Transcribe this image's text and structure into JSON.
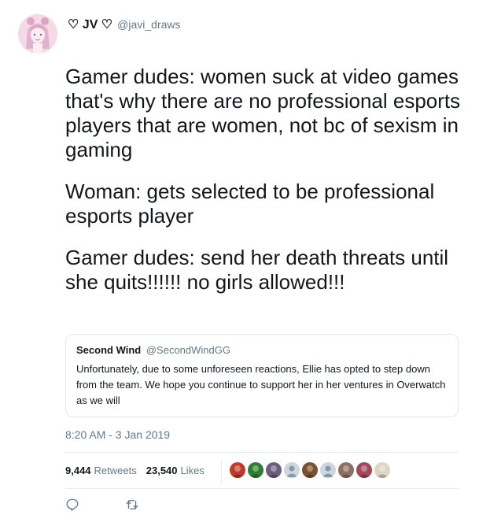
{
  "author": {
    "name": "♡ JV ♡",
    "handle": "@javi_draws"
  },
  "tweet": {
    "paragraphs": [
      "Gamer dudes: women suck at video games that's why there are no professional esports players that are women, not bc of sexism in gaming",
      "Woman: gets selected to be professional esports player",
      "Gamer dudes: send her death threats until she quits!!!!!! no girls allowed!!!"
    ]
  },
  "quoted_tweet": {
    "name": "Second Wind",
    "handle": "@SecondWindGG",
    "text": "Unfortunately, due to some unforeseen reactions, Ellie has opted to step down from the team. We hope you continue to support her in her ventures in Overwatch as we will"
  },
  "timestamp": "8:20 AM - 3 Jan 2019",
  "stats": {
    "retweets_count": "9,444",
    "retweets_label": "Retweets",
    "likes_count": "23,540",
    "likes_label": "Likes"
  },
  "likers": [
    {
      "icon": "liker-avatar-icon",
      "color": "#c0392b"
    },
    {
      "icon": "liker-avatar-icon",
      "color": "#2e7d32"
    },
    {
      "icon": "liker-avatar-icon",
      "color": "#6d5c7e"
    },
    {
      "icon": "default-avatar-icon",
      "color": "#ccd6dd"
    },
    {
      "icon": "liker-avatar-icon",
      "color": "#7a5230"
    },
    {
      "icon": "default-avatar-icon",
      "color": "#ccd6dd"
    },
    {
      "icon": "liker-avatar-icon",
      "color": "#8d6e63"
    },
    {
      "icon": "liker-avatar-icon",
      "color": "#a1485a"
    },
    {
      "icon": "liker-avatar-icon",
      "color": "#e0d5c5"
    }
  ],
  "actions": [
    {
      "icon": "reply-icon"
    },
    {
      "icon": "retweet-icon"
    }
  ],
  "colors": {
    "text": "#14171a",
    "secondary": "#657786",
    "border": "#e1e8ed"
  }
}
